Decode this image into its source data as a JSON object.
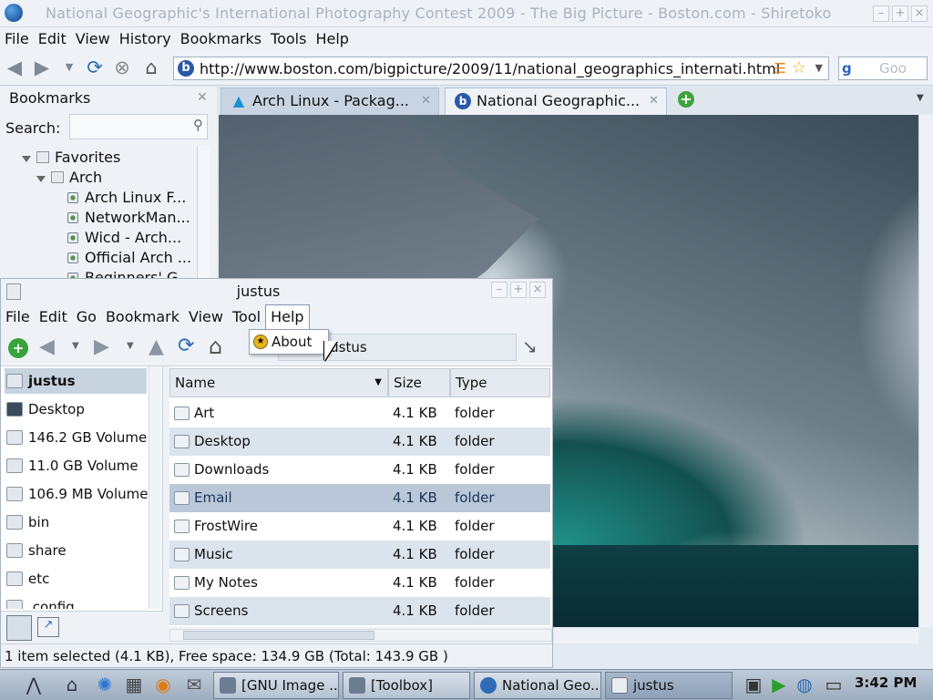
{
  "firefox": {
    "window_title": "National Geographic's International Photography Contest 2009 - The Big Picture - Boston.com - Shiretoko",
    "menu": [
      "File",
      "Edit",
      "View",
      "History",
      "Bookmarks",
      "Tools",
      "Help"
    ],
    "url": "http://www.boston.com/bigpicture/2009/11/national_geographics_internati.html",
    "search_placeholder": "Goo",
    "tabs": [
      {
        "label": "Arch Linux - Packag...",
        "active": false
      },
      {
        "label": "National Geographic...",
        "active": true
      }
    ]
  },
  "sidebar": {
    "title": "Bookmarks",
    "search_label": "Search:",
    "tree": {
      "favorites": "Favorites",
      "arch": "Arch",
      "items": [
        "Arch Linux F...",
        "NetworkMan...",
        "Wicd - Arch...",
        "Official Arch ...",
        "Beginners' G..."
      ]
    }
  },
  "filemanager": {
    "title": "justus",
    "menu": [
      "File",
      "Edit",
      "Go",
      "Bookmark",
      "View",
      "Tool",
      "Help"
    ],
    "help_menu_item": "About",
    "location": "justus",
    "places": [
      "justus",
      "Desktop",
      "146.2 GB Volume",
      "11.0 GB Volume",
      "106.9 MB Volume",
      "bin",
      "share",
      "etc",
      ".config"
    ],
    "columns": {
      "name": "Name",
      "size": "Size",
      "type": "Type"
    },
    "files": [
      {
        "name": "Art",
        "size": "4.1 KB",
        "type": "folder"
      },
      {
        "name": "Desktop",
        "size": "4.1 KB",
        "type": "folder"
      },
      {
        "name": "Downloads",
        "size": "4.1 KB",
        "type": "folder"
      },
      {
        "name": "Email",
        "size": "4.1 KB",
        "type": "folder"
      },
      {
        "name": "FrostWire",
        "size": "4.1 KB",
        "type": "folder"
      },
      {
        "name": "Music",
        "size": "4.1 KB",
        "type": "folder"
      },
      {
        "name": "My Notes",
        "size": "4.1 KB",
        "type": "folder"
      },
      {
        "name": "Screens",
        "size": "4.1 KB",
        "type": "folder"
      }
    ],
    "selected_file": "Email",
    "status": "1 item selected (4.1 KB), Free space: 134.9 GB (Total: 143.9 GB )"
  },
  "taskbar": {
    "tasks": [
      "[GNU Image ...",
      "[Toolbox]",
      "National Geo...",
      "justus"
    ],
    "clock": "3:42 PM"
  },
  "colors": {
    "accent": "#2a58a6",
    "selection": "#b9c7d8",
    "taskbar": "#9eadbf"
  }
}
